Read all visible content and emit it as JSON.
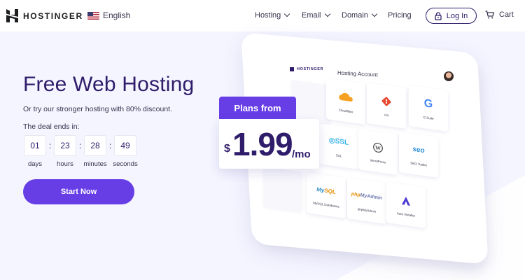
{
  "nav": {
    "brand": "HOSTINGER",
    "language": "English",
    "menu": [
      {
        "label": "Hosting",
        "dropdown": true
      },
      {
        "label": "Email",
        "dropdown": true
      },
      {
        "label": "Domain",
        "dropdown": true
      },
      {
        "label": "Pricing",
        "dropdown": false
      }
    ],
    "login_label": "Log In",
    "cart_label": "Cart"
  },
  "hero": {
    "title": "Free Web Hosting",
    "subtitle": "Or try our stronger hosting with 80% discount.",
    "deal_label": "The deal ends in:",
    "timer": [
      {
        "value": "01",
        "unit": "days"
      },
      {
        "value": "23",
        "unit": "hours"
      },
      {
        "value": "28",
        "unit": "minutes"
      },
      {
        "value": "49",
        "unit": "seconds"
      }
    ],
    "timer_separator": ":",
    "cta_label": "Start Now"
  },
  "price_card": {
    "header": "Plans from",
    "currency": "$",
    "amount": "1.99",
    "period": "/mo"
  },
  "mockup": {
    "brand": "HOSTINGER",
    "title": "Hosting Account",
    "tiles": [
      {
        "icon": "cloud-icon",
        "label": "Cloudflare"
      },
      {
        "icon": "git-icon",
        "label": "Git"
      },
      {
        "icon": "google-icon",
        "label": "G Suite"
      },
      {
        "icon": "ssl-icon",
        "label": "SSL"
      },
      {
        "icon": "wordpress-icon",
        "label": "WordPress"
      },
      {
        "icon": "seo-icon",
        "label": "SEO Toolkit"
      },
      {
        "icon": "mysql-icon",
        "label": "MySQL Databases"
      },
      {
        "icon": "phpmyadmin-icon",
        "label": "phpMyAdmin"
      },
      {
        "icon": "auto-installer-icon",
        "label": "Auto Installer"
      }
    ]
  },
  "colors": {
    "brand_primary": "#673de6",
    "brand_dark": "#2f1c6a",
    "page_bg": "#f4f5ff"
  }
}
